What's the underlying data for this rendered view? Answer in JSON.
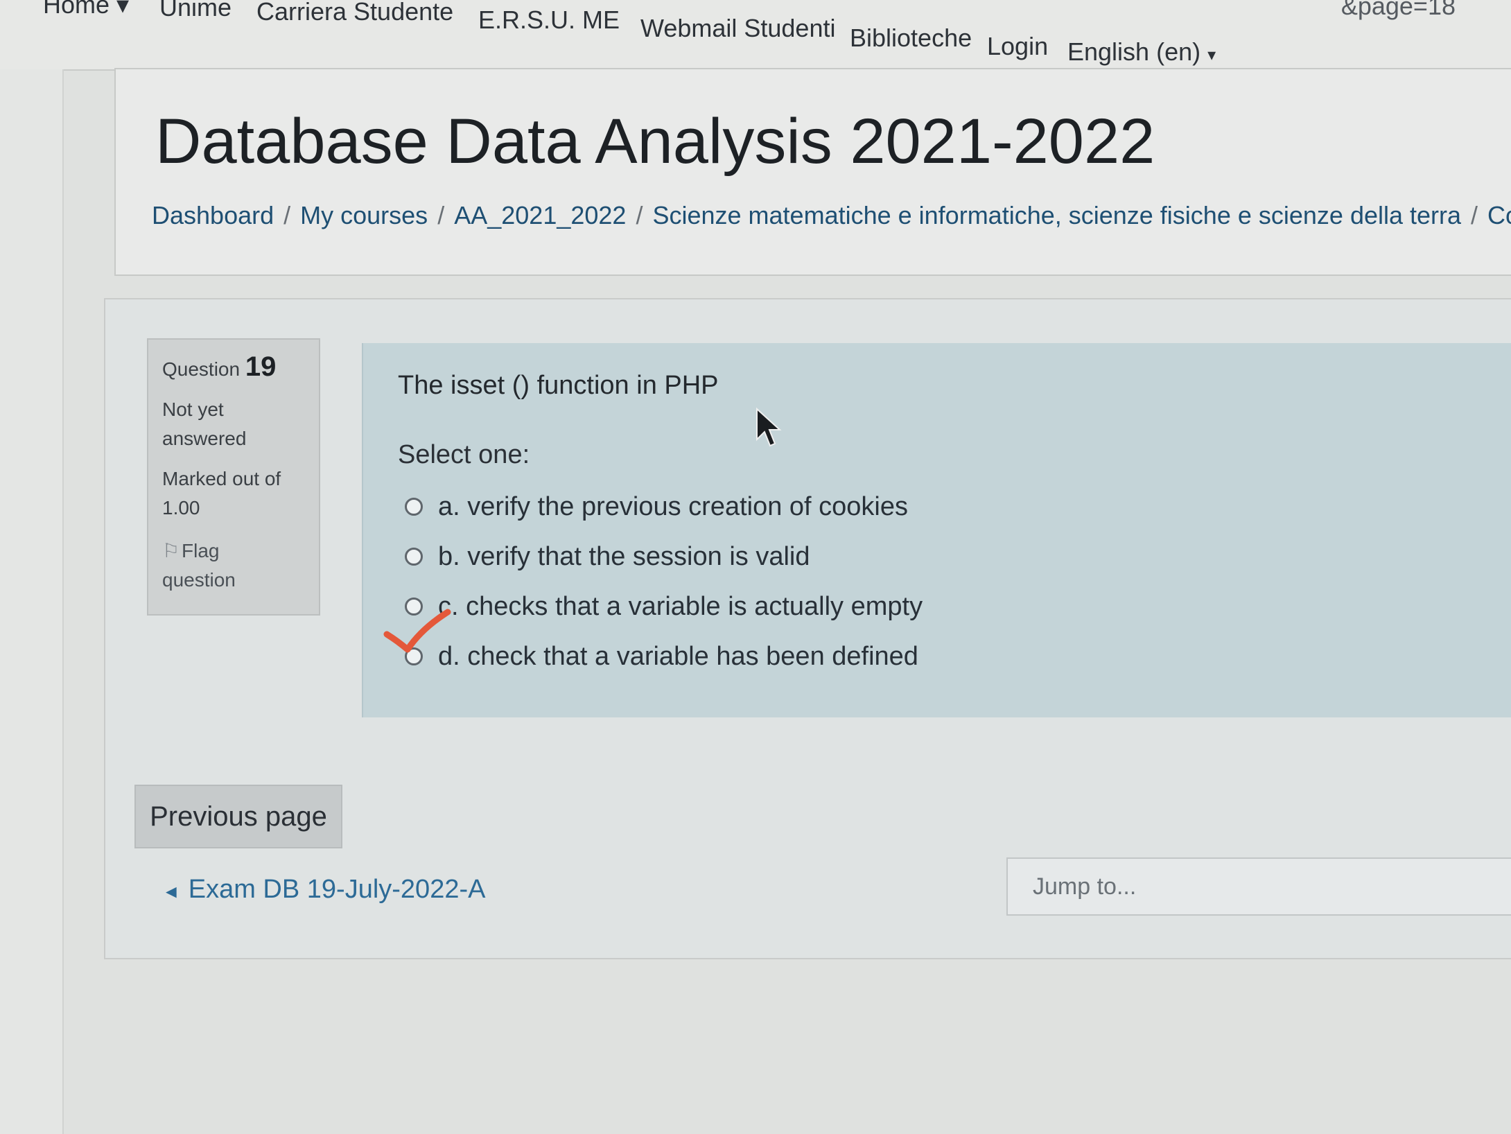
{
  "navbar": {
    "items": [
      "Home",
      "Unime",
      "Carriera Studente",
      "E.R.S.U. ME",
      "Webmail Studenti",
      "Biblioteche",
      "Login",
      "English (en)"
    ],
    "url_fragment": "&page=18"
  },
  "header": {
    "title": "Database Data Analysis 2021-2022",
    "breadcrumb": [
      "Dashboard",
      "My courses",
      "AA_2021_2022",
      "Scienze matematiche e informatiche, scienze fisiche e scienze della terra",
      "Corsi d"
    ]
  },
  "question_info": {
    "label": "Question",
    "number": "19",
    "state_line1": "Not yet",
    "state_line2": "answered",
    "mark_line1": "Marked out of",
    "mark_line2": "1.00",
    "flag_line1": "Flag",
    "flag_line2": "question",
    "flag_icon": "flag-icon"
  },
  "question": {
    "text": "The isset () function in PHP",
    "prompt": "Select one:",
    "answers": [
      "a. verify the previous creation of cookies",
      "b. verify that the session is valid",
      "c. checks that a variable is actually empty",
      "d. check that a variable has been defined"
    ]
  },
  "navigation": {
    "previous_page": "Previous page",
    "prev_activity": "Exam DB 19-July-2022-A",
    "jump_placeholder": "Jump to..."
  },
  "colors": {
    "link": "#2c6a96",
    "formulation_bg": "#c4d4d8",
    "check_mark": "#e4583a"
  }
}
